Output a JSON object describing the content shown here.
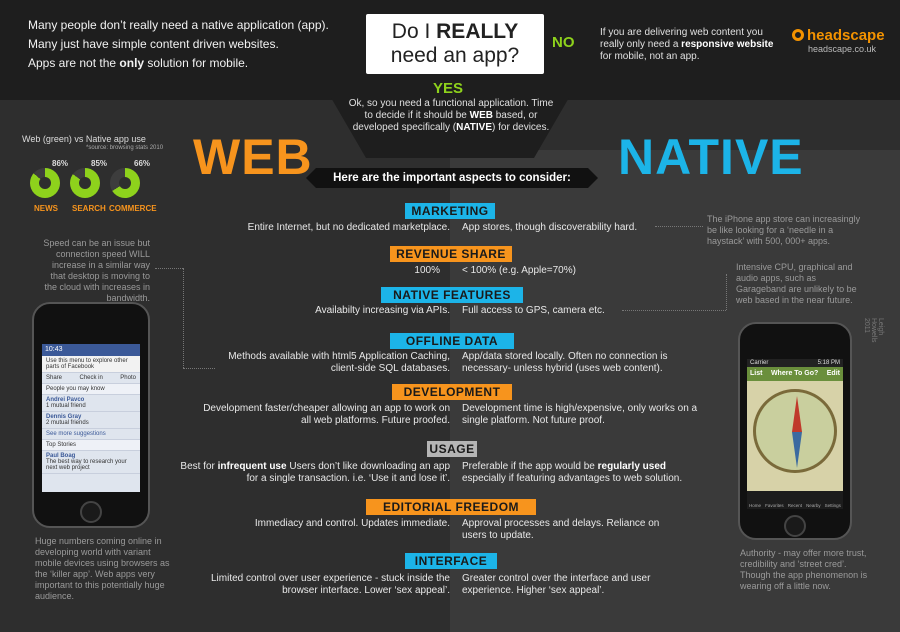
{
  "intro": [
    "Many people don’t really need a native application (app).",
    "Many just have simple content driven websites.",
    "Apps are not the only solution for mobile."
  ],
  "question": {
    "line1_pre": "Do I ",
    "line1_strong": "REALLY",
    "line2": "need an app?"
  },
  "no_label": "NO",
  "no_text_pre": "If you are delivering web content you really only need a ",
  "no_text_strong": "responsive website",
  "no_text_post": " for mobile, not an app.",
  "logo": {
    "name": "headscape",
    "url": "headscape.co.uk"
  },
  "yes_label": "YES",
  "yes_text_pre": "Ok, so you need a functional application. Time to decide if it should be ",
  "yes_web": "WEB",
  "yes_mid": " based, or developed specifically (",
  "yes_native": "NATIVE",
  "yes_end": ") for devices.",
  "web_title": "WEB",
  "native_title": "NATIVE",
  "aspects_label": "Here are the important aspects to consider:",
  "usage_stats": {
    "title": "Web (green) vs Native app use",
    "source": "*source: browsing stats 2010",
    "items": [
      {
        "label": "NEWS",
        "pct": "86%",
        "value": 86
      },
      {
        "label": "SEARCH",
        "pct": "85%",
        "value": 85
      },
      {
        "label": "COMMERCE",
        "pct": "66%",
        "value": 66
      }
    ]
  },
  "colors": {
    "web": "#f7941d",
    "native": "#1cb4e8",
    "green": "#8ed21c"
  },
  "aspects": [
    {
      "title": "MARKETING",
      "web": "Entire Internet, but no dedicated marketplace.",
      "native": "App stores, though discoverability hard."
    },
    {
      "title": "REVENUE SHARE",
      "web": "100%",
      "native": "< 100% (e.g. Apple=70%)"
    },
    {
      "title": "NATIVE FEATURES",
      "web": "Availabilty increasing via APIs.",
      "native": "Full access to GPS, camera etc."
    },
    {
      "title": "OFFLINE DATA",
      "web": "Methods available with html5 Application Caching, client-side SQL databases.",
      "native": "App/data stored locally. Often no connection is necessary- unless hybrid (uses web content)."
    },
    {
      "title": "DEVELOPMENT",
      "web": "Development faster/cheaper allowing an app to work on all web platforms. Future proofed.",
      "native": "Development time is high/expensive, only works on a single platform. Not future proof."
    },
    {
      "title": "USAGE",
      "web_pre": "Best for ",
      "web_strong": "infrequent use",
      "web_post": " Users don’t like downloading an app for a single transaction. i.e. ‘Use it and lose it’.",
      "native_pre": "Preferable if the app would be ",
      "native_strong": "regularly used",
      "native_post": " especially if featuring advantages to web solution."
    },
    {
      "title": "EDITORIAL FREEDOM",
      "web": "Immediacy and control. Updates immediate.",
      "native": "Approval processes and delays. Reliance on users to update."
    },
    {
      "title": "INTERFACE",
      "web": "Limited control over user experience - stuck inside the browser interface. Lower ‘sex appeal’.",
      "native": "Greater control over the interface and user experience. Higher ‘sex appeal’."
    }
  ],
  "side_notes": {
    "left_speed": "Speed can be an issue but connection speed WILL increase in a similar way that desktop is moving to the cloud with increases in bandwidth.",
    "left_bottom": "Huge numbers coming online in developing world with variant mobile devices using browsers as the ‘killer app’. Web apps very important to this potentially huge audience.",
    "right_appstore": "The iPhone app store can increasingly be like looking for a ‘needle in a haystack’ with 500, 000+ apps.",
    "right_cpu": "Intensive CPU, graphical and audio apps, such as Garageband are unlikely to be web based in the near future.",
    "right_bottom": "Authority - may offer more trust, credibility and ‘street cred’. Though the app phenomenon is wearing off a little now."
  },
  "credit": "Leigh Howells 2011",
  "web_phone": {
    "time": "10:43",
    "menu_hint": "Use this menu to explore other parts of Facebook",
    "actions": [
      "Share",
      "Check in",
      "Photo"
    ],
    "people_header": "People you may know",
    "people": [
      {
        "name": "Andrei Pavco",
        "sub": "1 mutual friend"
      },
      {
        "name": "Dennis Gray",
        "sub": "2 mutual friends"
      }
    ],
    "more": "See more suggestions",
    "stories_header": "Top Stories",
    "story_name": "Paul Boag",
    "story_text": "The best way to research your next web project"
  },
  "native_phone": {
    "carrier": "Carrier",
    "time": "5:18 PM",
    "title": "Where To Go?",
    "list_btn": "List",
    "edit_btn": "Edit",
    "tabs": [
      "Home",
      "Favorites",
      "Recent",
      "Nearby",
      "Settings"
    ]
  }
}
